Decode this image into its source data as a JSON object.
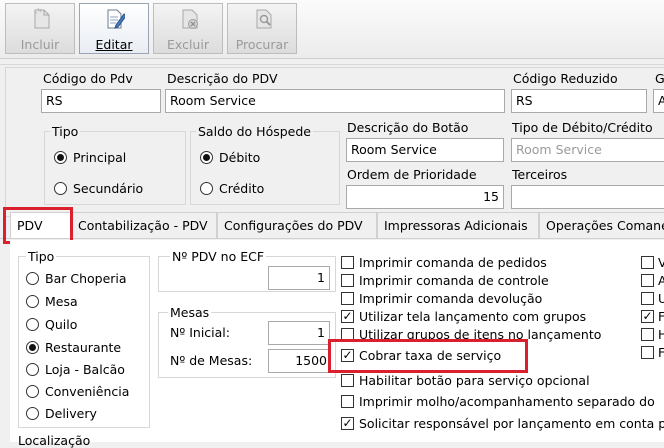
{
  "toolbar": {
    "incluir": "Incluir",
    "editar": "Editar",
    "excluir": "Excluir",
    "procurar": "Procurar"
  },
  "header": {
    "codigo_pdv_label": "Código do Pdv",
    "codigo_pdv_value": "RS",
    "descricao_pdv_label": "Descrição do PDV",
    "descricao_pdv_value": "Room Service",
    "codigo_reduzido_label": "Código Reduzido",
    "codigo_reduzido_value": "RS",
    "extra_label": "G",
    "extra_value": "A",
    "tipo_label": "Tipo",
    "tipo_principal": "Principal",
    "tipo_secundario": "Secundário",
    "saldo_label": "Saldo do Hóspede",
    "saldo_debito": "Débito",
    "saldo_credito": "Crédito",
    "descricao_botao_label": "Descrição do Botão",
    "descricao_botao_value": "Room Service",
    "tipo_debito_label": "Tipo de Débito/Crédito",
    "tipo_debito_value": "Room Service",
    "ordem_label": "Ordem de Prioridade",
    "ordem_value": "15",
    "terceiros_label": "Terceiros"
  },
  "tabs": [
    "PDV",
    "Contabilização - PDV",
    "Configurações do PDV",
    "Impressoras Adicionais",
    "Operações Comane"
  ],
  "pdv": {
    "tipo_label": "Tipo",
    "tipos": [
      "Bar Choperia",
      "Mesa",
      "Quilo",
      "Restaurante",
      "Loja - Balcão",
      "Conveniência",
      "Delivery"
    ],
    "tipo_selected": "Restaurante",
    "localizacao_label": "Localização",
    "ecf_label": "Nº PDV no ECF",
    "ecf_value": "1",
    "mesas_label": "Mesas",
    "inicial_label": "Nº Inicial:",
    "inicial_value": "1",
    "num_mesas_label": "Nº de Mesas:",
    "num_mesas_value": "1500",
    "options": [
      {
        "label": "Imprimir comanda de pedidos",
        "checked": false
      },
      {
        "label": "Imprimir comanda de controle",
        "checked": false
      },
      {
        "label": "Imprimir comanda devolução",
        "checked": false
      },
      {
        "label": "Utilizar tela lançamento com grupos",
        "checked": true
      },
      {
        "label": "Utilizar grupos de itens no lançamento",
        "checked": false
      },
      {
        "label": "Cobrar taxa de serviço",
        "checked": true
      },
      {
        "label": "Habilitar botão para serviço opcional",
        "checked": false
      },
      {
        "label": "Imprimir molho/acompanhamento separado do",
        "checked": false
      },
      {
        "label": "Solicitar responsável por lançamento em conta p",
        "checked": true
      }
    ],
    "right_col": [
      "V",
      "A",
      "U",
      "F",
      "H",
      "F"
    ]
  },
  "colors": {
    "highlight": "#d9202c"
  }
}
